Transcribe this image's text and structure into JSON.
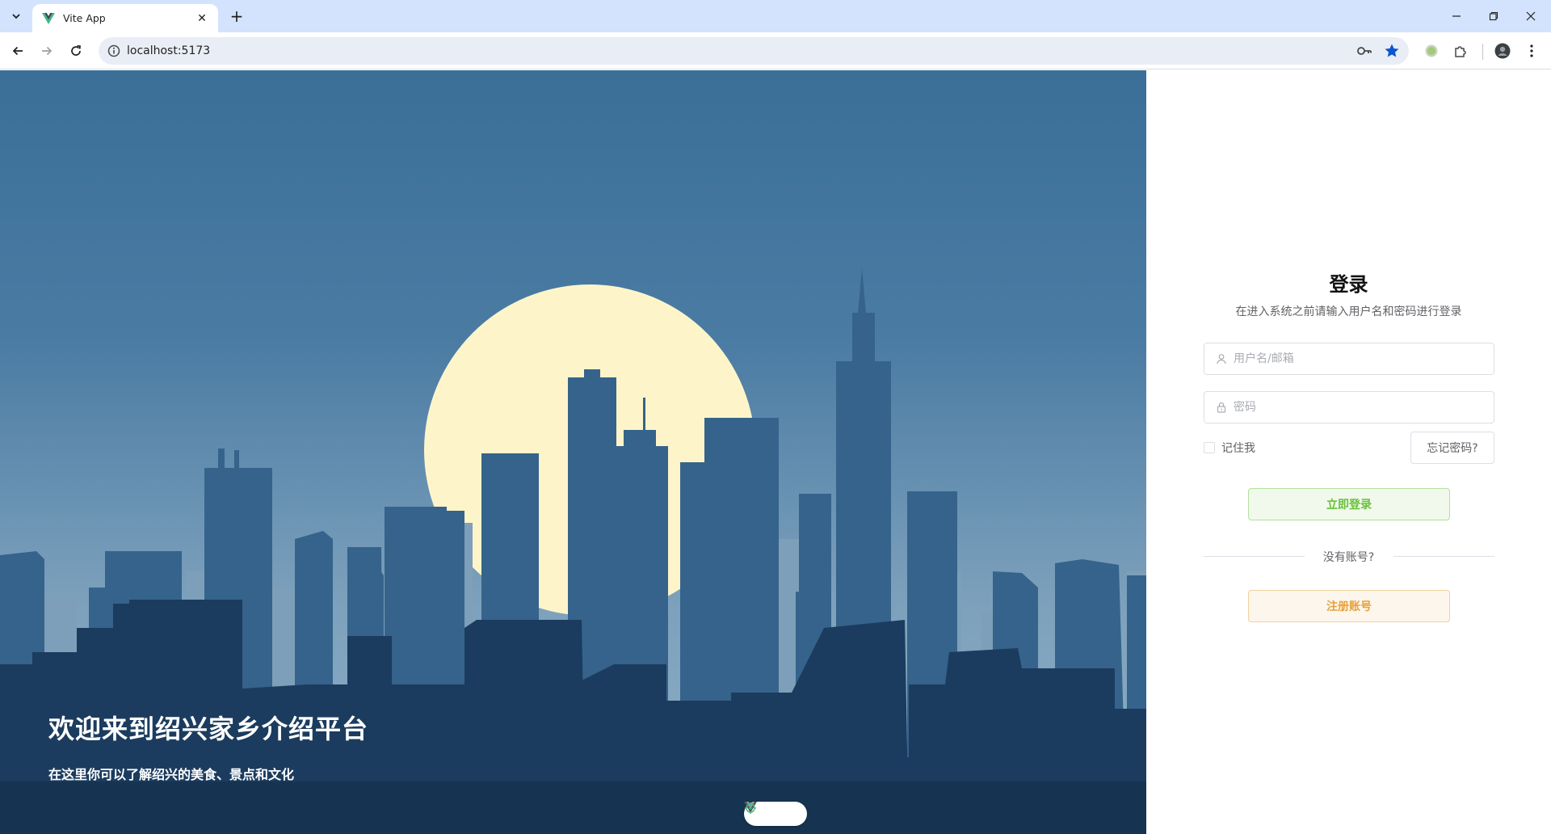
{
  "browser": {
    "tab_title": "Vite App",
    "url": "localhost:5173"
  },
  "hero": {
    "title": "欢迎来到绍兴家乡介绍平台",
    "subtitle": "在这里你可以了解绍兴的美食、景点和文化"
  },
  "login": {
    "title": "登录",
    "subtitle": "在进入系统之前请输入用户名和密码进行登录",
    "username_placeholder": "用户名/邮箱",
    "password_placeholder": "密码",
    "remember_label": "记住我",
    "forgot_label": "忘记密码?",
    "login_button": "立即登录",
    "divider_text": "没有账号?",
    "register_button": "注册账号"
  },
  "colors": {
    "login_button": "#67c23a",
    "register_button": "#e6a23c",
    "sky": "#3b6f98",
    "moon": "#fdf5c9"
  },
  "icons": {
    "favicon": "vue-logo-icon",
    "site_info": "info-icon",
    "password_manager": "key-icon",
    "bookmark": "star-icon",
    "extensions": "puzzle-icon"
  }
}
